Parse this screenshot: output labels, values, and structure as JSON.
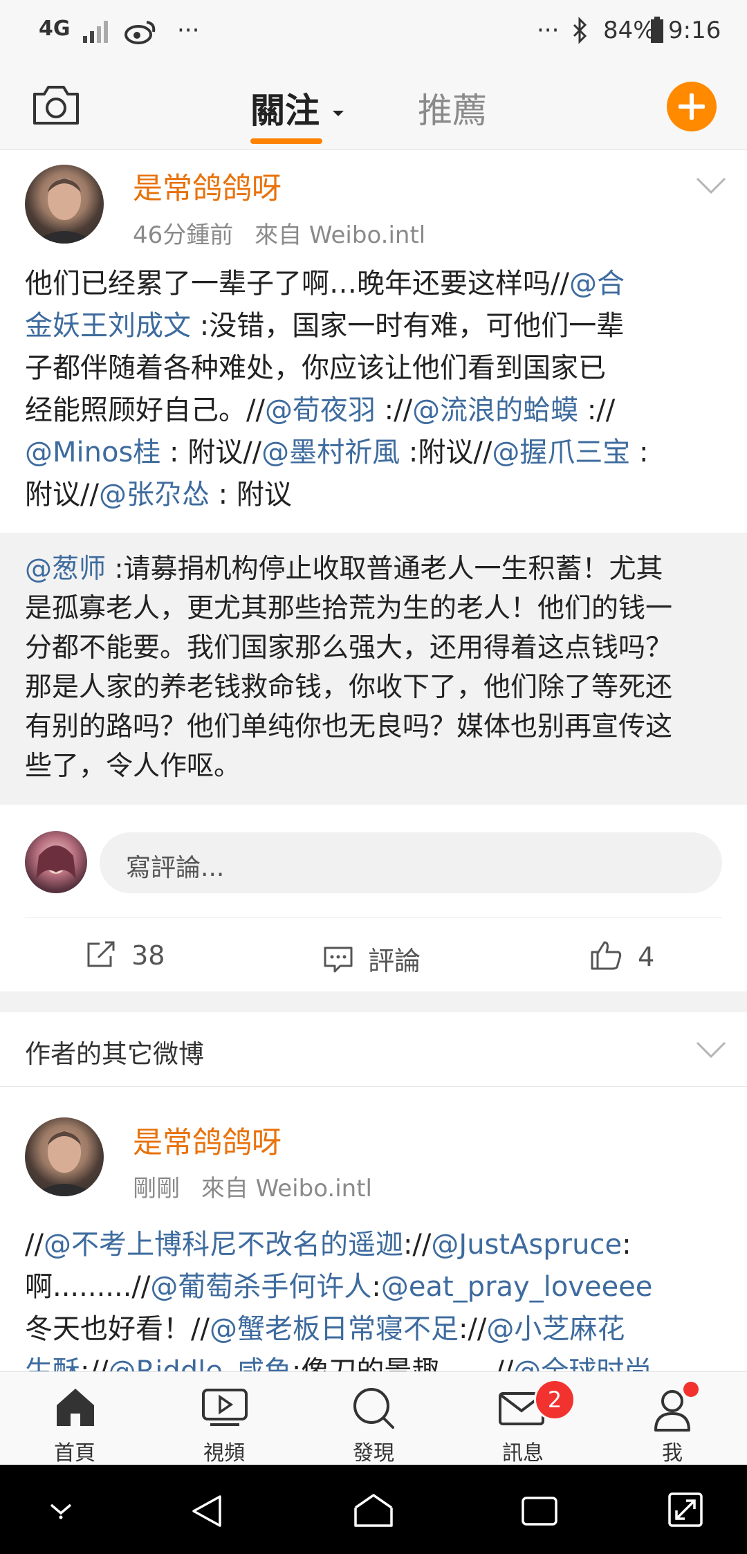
{
  "status_bar": {
    "network": "4G",
    "more_left": "···",
    "more_right": "···",
    "battery": "84%",
    "time": "9:16"
  },
  "top_nav": {
    "tab_follow": "關注",
    "tab_recommend": "推薦",
    "accent_color": "#ff8200"
  },
  "post": {
    "author": "是常鸽鸽呀",
    "time": "46分鍾前",
    "source": "來自 Weibo.intl",
    "text_lines": [
      [
        {
          "t": "他们已经累了一辈子了啊…晚年还要这样吗//"
        },
        {
          "t": "@合",
          "link": true
        }
      ],
      [
        {
          "t": "金妖王刘成文",
          "link": true
        },
        {
          "t": " :没错，国家一时有难，可他们一辈"
        }
      ],
      [
        {
          "t": "子都伴随着各种难处，你应该让他们看到国家已"
        }
      ],
      [
        {
          "t": "经能照顾好自己。//"
        },
        {
          "t": "@荀夜羽",
          "link": true
        },
        {
          "t": " ://"
        },
        {
          "t": "@流浪的蛤蟆",
          "link": true
        },
        {
          "t": " ://"
        }
      ],
      [
        {
          "t": "@Minos桂",
          "link": true
        },
        {
          "t": " : 附议//"
        },
        {
          "t": "@墨村祈風",
          "link": true
        },
        {
          "t": " :附议//"
        },
        {
          "t": "@握爪三宝",
          "link": true
        },
        {
          "t": " :"
        }
      ],
      [
        {
          "t": "附议//"
        },
        {
          "t": "@张尕怂",
          "link": true
        },
        {
          "t": " : 附议"
        }
      ]
    ],
    "repost_lines": [
      [
        {
          "t": "@葱师",
          "link": true
        },
        {
          "t": " :请募捐机构停止收取普通老人一生积蓄！尤其"
        }
      ],
      [
        {
          "t": "是孤寡老人，更尤其那些拾荒为生的老人！他们的钱一"
        }
      ],
      [
        {
          "t": "分都不能要。我们国家那么强大，还用得着这点钱吗？"
        }
      ],
      [
        {
          "t": "那是人家的养老钱救命钱，你收下了，他们除了等死还"
        }
      ],
      [
        {
          "t": "有别的路吗？他们单纯你也无良吗？媒体也别再宣传这"
        }
      ],
      [
        {
          "t": "些了，令人作呕。"
        }
      ]
    ],
    "comment_placeholder": "寫評論...",
    "share_count": "38",
    "comment_label": "評論",
    "like_count": "4"
  },
  "other_posts": {
    "header": "作者的其它微博",
    "author": "是常鸽鸽呀",
    "time": "剛剛",
    "source": "來自 Weibo.intl",
    "text_lines": [
      [
        {
          "t": "//"
        },
        {
          "t": "@不考上博科尼不改名的遥迦",
          "link": true
        },
        {
          "t": "://"
        },
        {
          "t": "@JustAspruce",
          "link": true
        },
        {
          "t": ":"
        }
      ],
      [
        {
          "t": "啊.........//"
        },
        {
          "t": "@葡萄杀手何许人",
          "link": true
        },
        {
          "t": ":"
        },
        {
          "t": "@eat_pray_loveeee",
          "link": true
        }
      ],
      [
        {
          "t": "冬天也好看！//"
        },
        {
          "t": "@蟹老板日常寝不足",
          "link": true
        },
        {
          "t": "://"
        },
        {
          "t": "@小芝麻花",
          "link": true
        }
      ],
      [
        {
          "t": "生酥",
          "link": true
        },
        {
          "t": "://"
        },
        {
          "t": "@Riddle_咸鱼",
          "link": true
        },
        {
          "t": ":像刀的景趣……//"
        },
        {
          "t": "@全球时尚",
          "link": true
        }
      ]
    ]
  },
  "bottom_nav": {
    "home": "首頁",
    "video": "視頻",
    "discover": "發現",
    "messages": "訊息",
    "messages_badge": "2",
    "me": "我"
  }
}
